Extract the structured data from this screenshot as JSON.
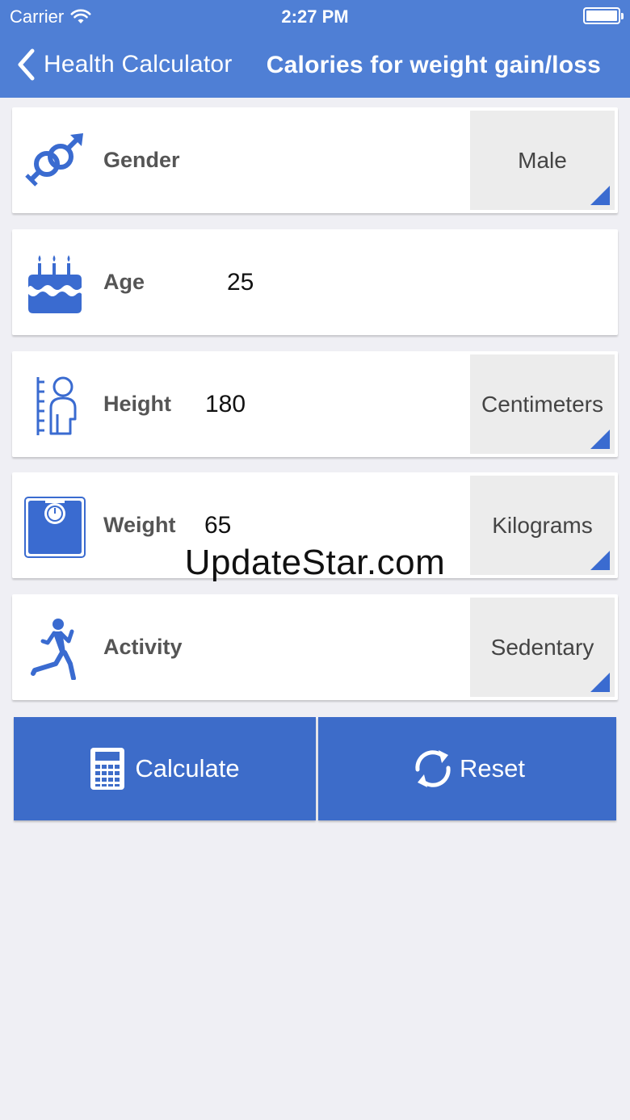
{
  "status_bar": {
    "carrier": "Carrier",
    "time": "2:27 PM"
  },
  "nav": {
    "back_label": "Health Calculator",
    "title": "Calories for weight gain/loss"
  },
  "rows": {
    "gender": {
      "label": "Gender",
      "unit": "Male"
    },
    "age": {
      "label": "Age",
      "value": "25"
    },
    "height": {
      "label": "Height",
      "value": "180",
      "unit": "Centimeters"
    },
    "weight": {
      "label": "Weight",
      "value": "65",
      "unit": "Kilograms"
    },
    "activity": {
      "label": "Activity",
      "unit": "Sedentary"
    }
  },
  "actions": {
    "calculate_label": "Calculate",
    "reset_label": "Reset"
  },
  "watermark": "UpdateStar.com",
  "colors": {
    "header": "#4f7fd5",
    "accent": "#3a6bd0",
    "button": "#3d6cc9",
    "background": "#efeff4"
  },
  "icons": [
    "wifi-icon",
    "battery-icon",
    "back-chevron-icon",
    "gender-icon",
    "birthday-cake-icon",
    "height-icon",
    "scale-icon",
    "running-icon",
    "calculator-icon",
    "refresh-icon"
  ]
}
